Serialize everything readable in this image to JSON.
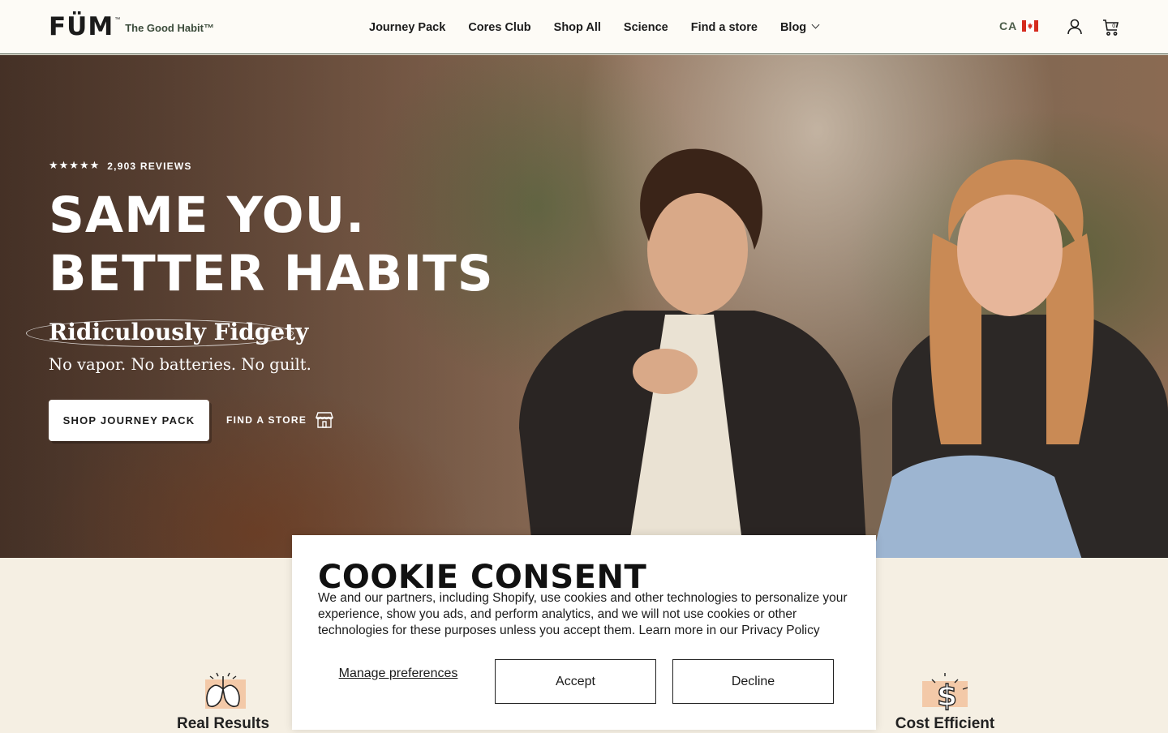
{
  "header": {
    "logo": "FÜM",
    "logo_tm": "™",
    "tagline": "The Good Habit™",
    "nav": [
      "Journey Pack",
      "Cores Club",
      "Shop All",
      "Science",
      "Find a store",
      "Blog"
    ],
    "region": "CA"
  },
  "hero": {
    "stars": "★★★★★",
    "reviews": "2,903 REVIEWS",
    "headline_line1": "SAME YOU.",
    "headline_line2": "BETTER HABITS",
    "subhead": "Ridiculously Fidgety",
    "tagline": "No vapor. No batteries. No guilt.",
    "cta_primary": "SHOP JOURNEY PACK",
    "cta_secondary": "FIND A STORE"
  },
  "features": [
    {
      "label": "Real Results",
      "icon": "lungs-icon"
    },
    {
      "label": "Cost Efficient",
      "icon": "dollar-icon"
    }
  ],
  "cookie": {
    "title": "COOKIE CONSENT",
    "body": "We and our partners, including Shopify, use cookies and other technologies to personalize your experience, show you ads, and perform analytics, and we will not use cookies or other technologies for these purposes unless you accept them. Learn more in our Privacy Policy",
    "manage": "Manage preferences",
    "accept": "Accept",
    "decline": "Decline"
  },
  "colors": {
    "header_bg": "#fdfbf6",
    "page_bg": "#f5efe3",
    "accent_green": "#3b4b3a",
    "flag_red": "#d52b1e"
  }
}
